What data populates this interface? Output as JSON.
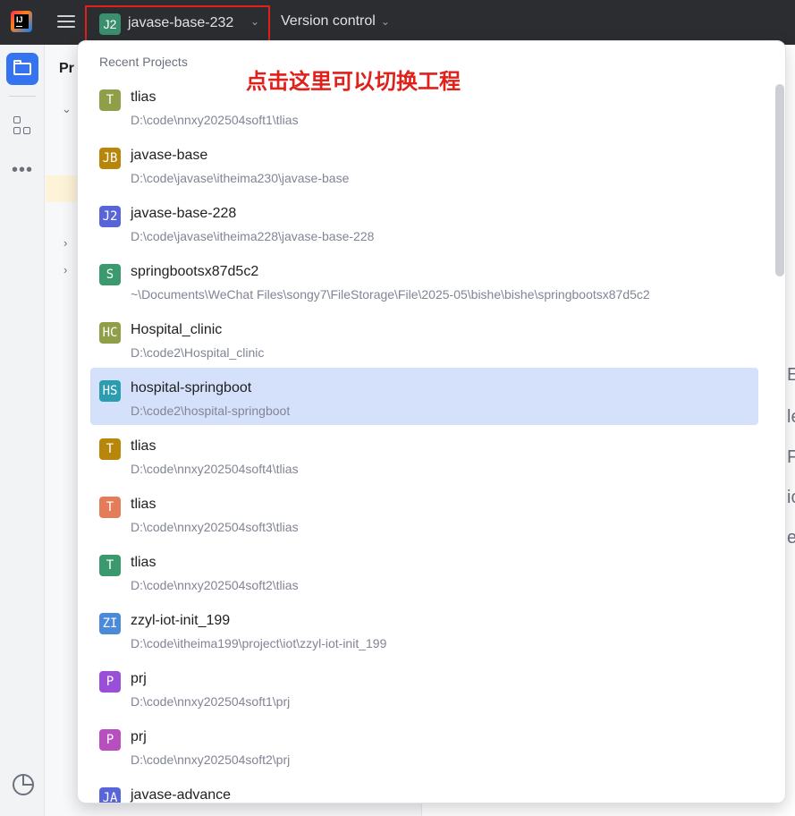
{
  "titlebar": {
    "project_badge": "J2",
    "project_name": "javase-base-232",
    "version_control": "Version control"
  },
  "background": {
    "panel_title": "Pr",
    "right_fragments": [
      "E",
      "le",
      "F",
      "ic",
      "es"
    ]
  },
  "popup": {
    "header": "Recent Projects",
    "annotation": "点击这里可以切换工程",
    "projects": [
      {
        "badge": "T",
        "color": "#8f9e48",
        "name": "tlias",
        "path": "D:\\code\\nnxy202504soft1\\tlias"
      },
      {
        "badge": "JB",
        "color": "#b8860b",
        "name": "javase-base",
        "path": "D:\\code\\javase\\itheima230\\javase-base"
      },
      {
        "badge": "J2",
        "color": "#5865d8",
        "name": "javase-base-228",
        "path": "D:\\code\\javase\\itheima228\\javase-base-228"
      },
      {
        "badge": "S",
        "color": "#3a9a6e",
        "name": "springbootsx87d5c2",
        "path": "~\\Documents\\WeChat Files\\songy7\\FileStorage\\File\\2025-05\\bishe\\bishe\\springbootsx87d5c2"
      },
      {
        "badge": "HC",
        "color": "#8f9e48",
        "name": "Hospital_clinic",
        "path": "D:\\code2\\Hospital_clinic"
      },
      {
        "badge": "HS",
        "color": "#2a9db0",
        "name": "hospital-springboot",
        "path": "D:\\code2\\hospital-springboot",
        "selected": true
      },
      {
        "badge": "T",
        "color": "#b8860b",
        "name": "tlias",
        "path": "D:\\code\\nnxy202504soft4\\tlias"
      },
      {
        "badge": "T",
        "color": "#e47b59",
        "name": "tlias",
        "path": "D:\\code\\nnxy202504soft3\\tlias"
      },
      {
        "badge": "T",
        "color": "#3a9a6e",
        "name": "tlias",
        "path": "D:\\code\\nnxy202504soft2\\tlias"
      },
      {
        "badge": "ZI",
        "color": "#4a8ad8",
        "name": "zzyl-iot-init_199",
        "path": "D:\\code\\itheima199\\project\\iot\\zzyl-iot-init_199"
      },
      {
        "badge": "P",
        "color": "#9a4fd8",
        "name": "prj",
        "path": "D:\\code\\nnxy202504soft1\\prj"
      },
      {
        "badge": "P",
        "color": "#b84fbf",
        "name": "prj",
        "path": "D:\\code\\nnxy202504soft2\\prj"
      },
      {
        "badge": "JA",
        "color": "#5865d8",
        "name": "javase-advance",
        "path": ""
      }
    ]
  },
  "colors": {
    "accent": "#3574f0",
    "highlight_box": "#e0201b",
    "selected_row": "#d5e1fb"
  }
}
